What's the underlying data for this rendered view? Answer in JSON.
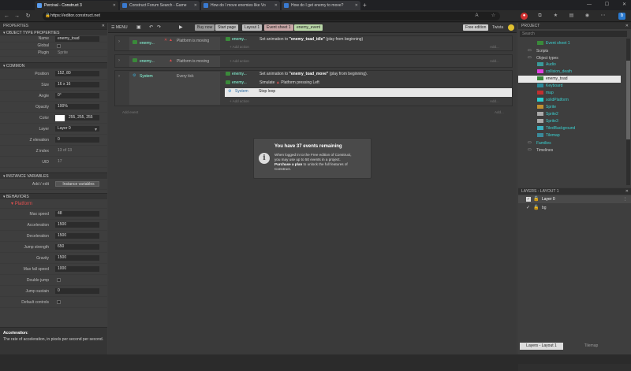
{
  "browser": {
    "tabs": [
      {
        "title": "Percival - Construct 3",
        "color": "#5a9df0"
      },
      {
        "title": "Construct Forum Search - Game",
        "color": "#3a7ad0"
      },
      {
        "title": "How do I move enemies like Vo",
        "color": "#3a7ad0"
      },
      {
        "title": "How do I get enemy to move?",
        "color": "#3a7ad0"
      }
    ],
    "url": "https://editor.construct.net"
  },
  "properties": {
    "header": "PROPERTIES",
    "object_type_section": "OBJECT TYPE PROPERTIES",
    "name_label": "Name",
    "name_value": "enemy_toad",
    "global_label": "Global",
    "plugin_label": "Plugin",
    "plugin_value": "Sprite",
    "common_section": "COMMON",
    "position_label": "Position",
    "position_value": "152, 80",
    "size_label": "Size",
    "size_value": "16 x 16",
    "angle_label": "Angle",
    "angle_value": "0°",
    "opacity_label": "Opacity",
    "opacity_value": "100%",
    "color_label": "Color",
    "color_value": "255, 255, 255",
    "layer_label": "Layer",
    "layer_value": "Layer 0",
    "zelev_label": "Z elevation",
    "zelev_value": "0",
    "zindex_label": "Z index",
    "zindex_value": "13 of 13",
    "uid_label": "UID",
    "uid_value": "17",
    "instvars_section": "INSTANCE VARIABLES",
    "addedit_label": "Add / edit",
    "addedit_value": "Instance variables",
    "behaviors_section": "BEHAVIORS",
    "platform_label": "Platform",
    "maxspeed_label": "Max speed",
    "maxspeed_value": "48",
    "accel_label": "Acceleration",
    "accel_value": "1500",
    "decel_label": "Deceleration",
    "decel_value": "1500",
    "jump_label": "Jump strength",
    "jump_value": "650",
    "gravity_label": "Gravity",
    "gravity_value": "1500",
    "maxfall_label": "Max fall speed",
    "maxfall_value": "1000",
    "double_label": "Double jump",
    "sustain_label": "Jump sustain",
    "sustain_value": "0",
    "defctrl_label": "Default controls",
    "help_title": "Acceleration:",
    "help_text": "The rate of acceleration, in pixels per second per second."
  },
  "toolbar": {
    "menu": "MENU",
    "buy_now": "Buy now",
    "start_page": "Start page",
    "layout1": "Layout 1",
    "event_sheet": "Event sheet 1",
    "enemy_event": "enemy_event",
    "free_edition": "Free edition",
    "user": "Twista"
  },
  "events": {
    "ev1_obj": "enemy...",
    "ev1_cond": "Platform is moving",
    "ev1_act_obj": "enemy...",
    "ev1_act_pre": "Set animation to ",
    "ev1_act_anim": "\"enemy_toad_idle\"",
    "ev1_act_post": " (play from beginning)",
    "add_action": "Add action",
    "add_dots": "Add...",
    "ev2_obj": "enemy...",
    "ev2_cond": "Platform is moving",
    "ev3_obj": "System",
    "ev3_cond": "Every tick",
    "ev3_act1_obj": "enemy...",
    "ev3_act1_pre": "Set animation to ",
    "ev3_act1_anim": "\"enemy_toad_move\"",
    "ev3_act1_post": " (play from beginning).",
    "ev3_act2_obj": "enemy...",
    "ev3_act2_pre": "Simulate ",
    "ev3_act2_post": "Platform pressing Left",
    "ev3_act3_obj": "System",
    "ev3_act3": "Stop loop",
    "add_event": "Add event"
  },
  "notice": {
    "title": "You have 37 events remaining",
    "line1": "When logged in to the Free edition of Construct,",
    "line2": "you may use up to 50 events in a project.",
    "link": "Purchase a plan",
    "line3": " to unlock the full features of",
    "line4": "Construct."
  },
  "project": {
    "header": "PROJECT",
    "search_placeholder": "Search",
    "items": [
      {
        "label": "Event sheet 1",
        "kind": "sheet"
      },
      {
        "label": "Scripts",
        "kind": "folder"
      },
      {
        "label": "Object types",
        "kind": "folder"
      },
      {
        "label": "Audio",
        "kind": "obj",
        "color": "#3a9a9a"
      },
      {
        "label": "collision_death",
        "kind": "obj",
        "color": "#e040e0"
      },
      {
        "label": "enemy_toad",
        "kind": "obj",
        "color": "#3a8a3a"
      },
      {
        "label": "Keyboard",
        "kind": "obj",
        "color": "#2a8a9a"
      },
      {
        "label": "map",
        "kind": "obj",
        "color": "#c03030"
      },
      {
        "label": "solidPlatform",
        "kind": "obj",
        "color": "#2ad0d0"
      },
      {
        "label": "Sprite",
        "kind": "obj",
        "color": "#c09030"
      },
      {
        "label": "Sprite2",
        "kind": "obj",
        "color": "#aaaaaa"
      },
      {
        "label": "Sprite3",
        "kind": "obj",
        "color": "#aaaaaa"
      },
      {
        "label": "TiledBackground",
        "kind": "obj",
        "color": "#3ab0c0"
      },
      {
        "label": "Tilemap",
        "kind": "obj",
        "color": "#3a8a9a"
      },
      {
        "label": "Families",
        "kind": "folder"
      },
      {
        "label": "Timelines",
        "kind": "folder"
      }
    ]
  },
  "layers": {
    "header": "LAYERS - LAYOUT 1",
    "items": [
      "Layer 0",
      "bg"
    ],
    "tab_active": "Layers - Layout 1",
    "tab_inactive": "Tilemap"
  }
}
